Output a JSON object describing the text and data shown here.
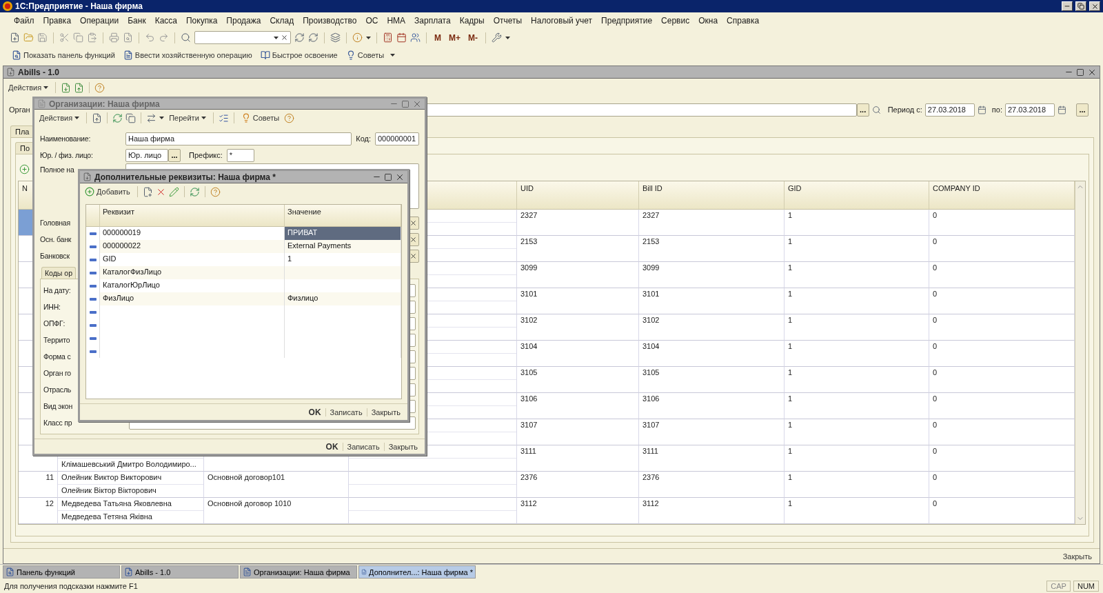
{
  "app_title": "1С:Предприятие - Наша фирма",
  "menu": [
    "Файл",
    "Правка",
    "Операции",
    "Банк",
    "Касса",
    "Покупка",
    "Продажа",
    "Склад",
    "Производство",
    "ОС",
    "НМА",
    "Зарплата",
    "Кадры",
    "Отчеты",
    "Налоговый учет",
    "Предприятие",
    "Сервис",
    "Окна",
    "Справка"
  ],
  "memory_buttons": [
    "M",
    "M+",
    "M-"
  ],
  "quick_bar": [
    {
      "kind": "panel",
      "label": "Показать панель функций"
    },
    {
      "kind": "operation",
      "label": "Ввести хозяйственную операцию"
    },
    {
      "kind": "learn",
      "label": "Быстрое освоение"
    },
    {
      "kind": "tips",
      "label": "Советы"
    }
  ],
  "main_window": {
    "title": "Abills - 1.0",
    "actions": "Действия",
    "filter_label": "Орган",
    "filter_select": "...",
    "period_from_label": "Период с:",
    "period_from": "27.03.2018",
    "period_to_label": "по:",
    "period_to": "27.03.2018",
    "period_button": "...",
    "outer_tab": "Пла",
    "inner_tab": "По",
    "table": {
      "columns": [
        "N",
        "UID",
        "Bill ID",
        "GID",
        "COMPANY ID"
      ],
      "rows": [
        {
          "uid": "2327",
          "bill_id": "2327",
          "gid": "1",
          "company_id": "0",
          "selected": true
        },
        {
          "uid": "2153",
          "bill_id": "2153",
          "gid": "1",
          "company_id": "0",
          "selected": false
        },
        {
          "uid": "3099",
          "bill_id": "3099",
          "gid": "1",
          "company_id": "0",
          "selected": false
        },
        {
          "uid": "3101",
          "bill_id": "3101",
          "gid": "1",
          "company_id": "0",
          "selected": false
        },
        {
          "uid": "3102",
          "bill_id": "3102",
          "gid": "1",
          "company_id": "0",
          "selected": false
        },
        {
          "uid": "3104",
          "bill_id": "3104",
          "gid": "1",
          "company_id": "0",
          "selected": false
        },
        {
          "uid": "3105",
          "bill_id": "3105",
          "gid": "1",
          "company_id": "0",
          "selected": false
        },
        {
          "uid": "3106",
          "bill_id": "3106",
          "gid": "1",
          "company_id": "0",
          "selected": false
        },
        {
          "uid": "3107",
          "bill_id": "3107",
          "gid": "1",
          "company_id": "0",
          "selected": false
        },
        {
          "name_alt": "Клімашевський Дмитро Володимиро...",
          "uid": "3111",
          "bill_id": "3111",
          "gid": "1",
          "company_id": "0",
          "selected": false
        },
        {
          "n": "11",
          "name": "Олейник Виктор Викторович",
          "name_alt": "Олейник Віктор Вікторович",
          "contract": "Основной договор101",
          "uid": "2376",
          "bill_id": "2376",
          "gid": "1",
          "company_id": "0",
          "selected": false
        },
        {
          "n": "12",
          "name": "Медведева Татьяна Яковлевна",
          "name_alt": "Медведева Тетяна Яківна",
          "contract": "Основной договор 1010",
          "uid": "3112",
          "bill_id": "3112",
          "gid": "1",
          "company_id": "0",
          "selected": false
        }
      ]
    },
    "close_button": "Закрыть"
  },
  "org_dialog": {
    "title": "Организации: Наша фирма",
    "actions": "Действия",
    "goto": "Перейти",
    "tips": "Советы",
    "name_label": "Наименование:",
    "name": "Наша фирма",
    "code_label": "Код:",
    "code": "000000001",
    "type_label": "Юр. / физ. лицо:",
    "type": "Юр. лицо",
    "type_select": "...",
    "prefix_label": "Префикс:",
    "prefix": "*",
    "full_name_label": "Полное на",
    "link_labels": [
      "Головная",
      "Осн. банк",
      "Банковск"
    ],
    "tab": "Коды ор",
    "tab_labels": [
      "На дату:",
      "ИНН:",
      "ОПФГ:",
      "Террито",
      "Форма с",
      "Орган го",
      "Отрасль",
      "Вид экон",
      "Класс пр"
    ],
    "buttons": [
      {
        "label": "OK",
        "default": true
      },
      {
        "label": "Записать",
        "default": false
      },
      {
        "label": "Закрыть",
        "default": false
      }
    ]
  },
  "attr_dialog": {
    "title": "Дополнительные реквизиты: Наша фирма *",
    "add": "Добавить",
    "columns": [
      "Реквизит",
      "Значение"
    ],
    "rows": [
      {
        "kind": "item",
        "name": "000000019",
        "value": "ПРИВАТ",
        "selected": true
      },
      {
        "kind": "item",
        "name": "000000022",
        "value": "External Payments",
        "selected": false
      },
      {
        "kind": "item",
        "name": "GID",
        "value": "1",
        "selected": false
      },
      {
        "kind": "item",
        "name": "КаталогФизЛицо",
        "selected": false
      },
      {
        "kind": "item",
        "name": "КаталогЮрЛицо",
        "selected": false
      },
      {
        "kind": "item",
        "name": "ФизЛицо",
        "value": "Физлицо",
        "selected": false
      },
      {
        "kind": "empty",
        "selected": false
      },
      {
        "kind": "empty",
        "selected": false
      },
      {
        "kind": "empty",
        "selected": false
      },
      {
        "kind": "empty",
        "selected": false
      }
    ],
    "buttons": [
      {
        "label": "OK",
        "default": true
      },
      {
        "label": "Записать",
        "default": false
      },
      {
        "label": "Закрыть",
        "default": false
      }
    ]
  },
  "taskbar": [
    {
      "kind": "panel",
      "label": "Панель функций",
      "selected": false
    },
    {
      "kind": "processing",
      "label": "Abills - 1.0",
      "selected": false
    },
    {
      "kind": "form",
      "label": "Организации: Наша фирма",
      "selected": false
    },
    {
      "kind": "processing",
      "label": "Дополнител...: Наша фирма *",
      "selected": true
    }
  ],
  "status_bar": {
    "hint": "Для получения подсказки нажмите F1",
    "indicators": [
      "CAP",
      "NUM"
    ]
  }
}
